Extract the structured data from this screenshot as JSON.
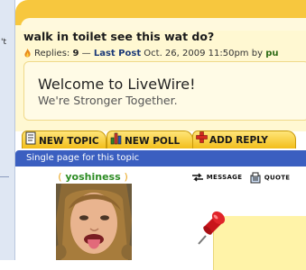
{
  "left_edge": {
    "label": "'t"
  },
  "topic": {
    "title": "walk in toilet see this wat do?",
    "replies_label": "Replies:",
    "replies_count": "9",
    "separator": "—",
    "last_post_label": "Last Post",
    "last_post_date": "Oct. 26, 2009 11:50pm",
    "by_label": "by",
    "last_poster": "pu"
  },
  "welcome": {
    "title": "Welcome to LiveWire!",
    "subtitle": "We're Stronger Together."
  },
  "tabs": [
    {
      "label": "NEW TOPIC",
      "icon": "document-icon"
    },
    {
      "label": "NEW POLL",
      "icon": "bar-chart-icon"
    },
    {
      "label": "ADD REPLY",
      "icon": "plus-icon"
    }
  ],
  "pagebar": {
    "text": "Single page for this topic"
  },
  "post": {
    "username": "yoshiness",
    "username_bracket_open": "(",
    "username_bracket_close": ")",
    "message_label": "MESSAGE",
    "quote_label": "QUOTE"
  },
  "colors": {
    "accent_yellow": "#f2be1a",
    "pagebar_blue": "#3b5fc0",
    "username_green": "#2d8c24",
    "link_blue": "#1c3a78"
  }
}
